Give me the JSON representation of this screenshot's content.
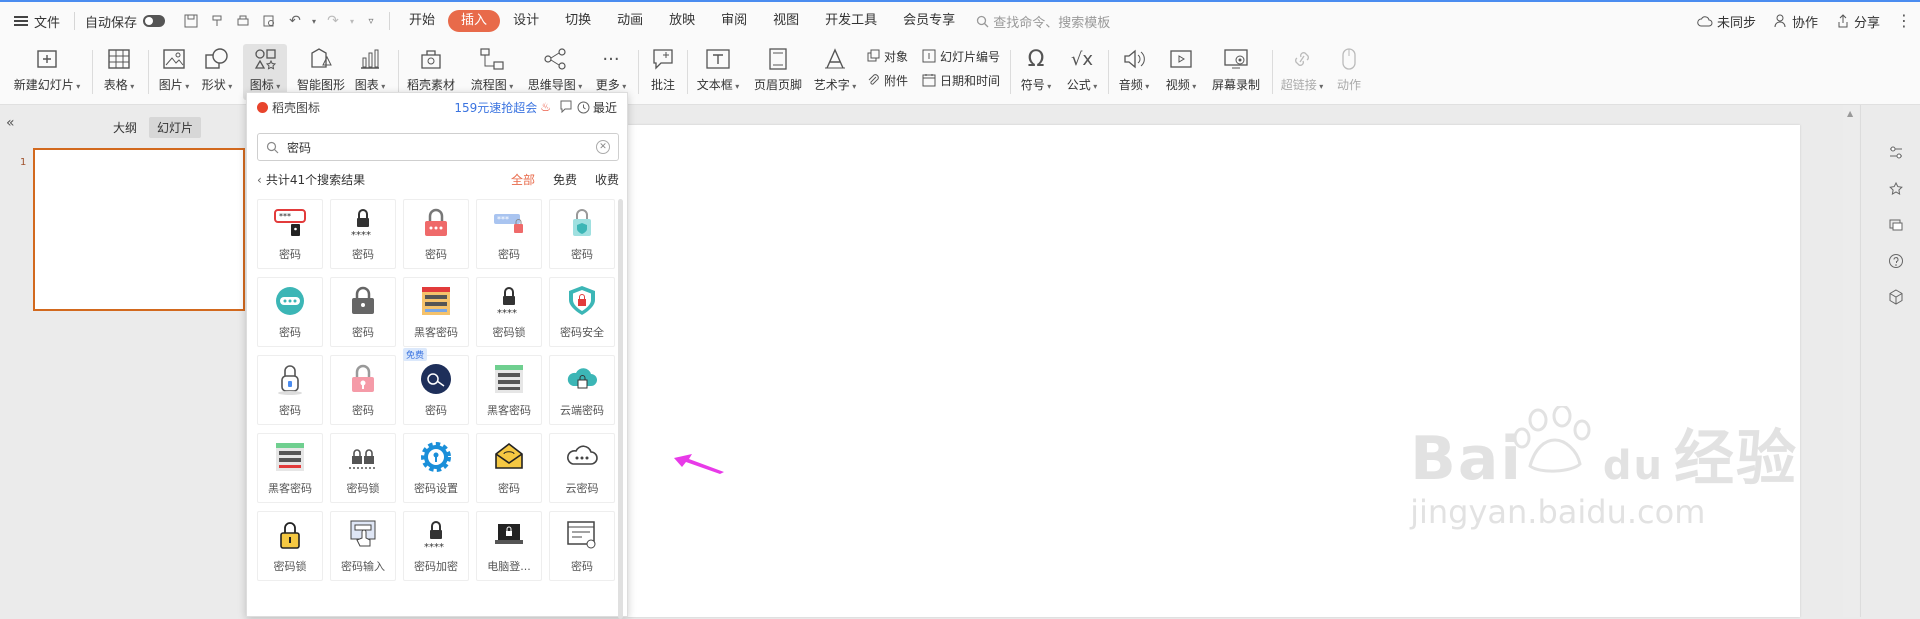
{
  "menubar": {
    "file": "文件",
    "autosave": "自动保存",
    "tabs": [
      {
        "label": "开始",
        "active": false
      },
      {
        "label": "插入",
        "active": true
      },
      {
        "label": "设计",
        "active": false
      },
      {
        "label": "切换",
        "active": false
      },
      {
        "label": "动画",
        "active": false
      },
      {
        "label": "放映",
        "active": false
      },
      {
        "label": "审阅",
        "active": false
      },
      {
        "label": "视图",
        "active": false
      },
      {
        "label": "开发工具",
        "active": false
      },
      {
        "label": "会员专享",
        "active": false
      }
    ],
    "search_placeholder": "查找命令、搜索模板",
    "sync": "未同步",
    "collab": "协作",
    "share": "分享"
  },
  "ribbon": {
    "new_slide": "新建幻灯片",
    "table": "表格",
    "picture": "图片",
    "shape": "形状",
    "icon": "图标",
    "smart_shape": "智能图形",
    "chart": "图表",
    "daoke": "稻壳素材",
    "flowchart": "流程图",
    "mindmap": "思维导图",
    "more": "更多",
    "comment": "批注",
    "textbox": "文本框",
    "header_footer": "页眉页脚",
    "wordart": "艺术字",
    "object": "对象",
    "slide_number": "幻灯片编号",
    "attachment": "附件",
    "datetime": "日期和时间",
    "symbol": "符号",
    "formula": "公式",
    "audio": "音频",
    "video": "视频",
    "screen_record": "屏幕录制",
    "hyperlink": "超链接",
    "action": "动作"
  },
  "leftpane": {
    "outline": "大纲",
    "slides": "幻灯片",
    "slide_number": "1"
  },
  "iconpanel": {
    "brand": "稻壳图标",
    "promo": "159元速抢超会",
    "recent": "最近",
    "search_value": "密码",
    "result_count": "共计41个搜索结果",
    "filters": [
      "全部",
      "免费",
      "收费"
    ],
    "free_tag": "免费",
    "items": [
      "密码",
      "密码",
      "密码",
      "密码",
      "密码",
      "密码",
      "密码",
      "黑客密码",
      "密码锁",
      "密码安全",
      "密码",
      "密码",
      "密码",
      "黑客密码",
      "云端密码",
      "黑客密码",
      "密码锁",
      "密码设置",
      "密码",
      "云密码",
      "密码锁",
      "密码输入",
      "密码加密",
      "电脑登...",
      "密码"
    ]
  },
  "watermark": {
    "brand": "Bai",
    "brand2": "du",
    "brand_cn": "经验",
    "url": "jingyan.baidu.com"
  },
  "colors": {
    "accent": "#e86a4a",
    "link_blue": "#3b74e0",
    "slide_border": "#d2691e",
    "arrow": "#e83ae8"
  }
}
